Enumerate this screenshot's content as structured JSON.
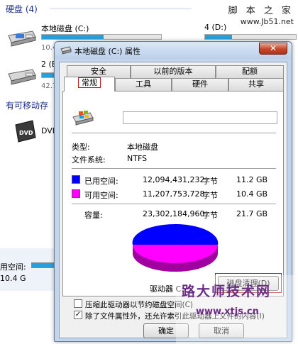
{
  "explorer": {
    "hard_disks_header": "硬盘 (4)",
    "removable_header": "有可移动存",
    "drive_c": {
      "name": "本地磁盘 (C:)",
      "sub": "10.4",
      "used_fraction": 0.52
    },
    "drive_d": {
      "name": "4 (D:)"
    },
    "drive_e": {
      "name": "2 (E",
      "sub": "42.7"
    },
    "dvd": {
      "name": "DVD"
    },
    "status_used": "用空间:",
    "status_free": "10.4 G",
    "watermark_top": "脚 本 之 家",
    "watermark_url": "www.Jb51.net"
  },
  "dialog": {
    "title": "本地磁盘 (C:) 属性",
    "close_glyph": "✕",
    "tabs_row1": [
      "安全",
      "以前的版本",
      "配额"
    ],
    "tabs_row2": [
      "常规",
      "工具",
      "硬件",
      "共享"
    ],
    "type_label": "类型:",
    "type_value": "本地磁盘",
    "fs_label": "文件系统:",
    "fs_value": "NTFS",
    "used_label": "已用空间:",
    "used_bytes": "12,094,431,232",
    "used_unit": "字节",
    "used_gb": "11.2 GB",
    "free_label": "可用空间:",
    "free_bytes": "11,207,753,728",
    "free_unit": "字节",
    "free_gb": "10.4 GB",
    "capacity_label": "容量:",
    "capacity_bytes": "23,302,184,960",
    "capacity_unit": "字节",
    "capacity_gb": "21.7 GB",
    "drive_label": "驱动器 C:",
    "cleanup_button": "磁盘清理(D)",
    "compress_label": "压缩此驱动器以节约磁盘空间(C)",
    "index_label": "除了文件属性外，还允许索引此驱动器上文件的内容(I)",
    "index_checked": "✓",
    "ok_button": "确定",
    "cancel_button": "取消",
    "used_color": "#0000ff",
    "free_color": "#ff00ff"
  },
  "bottom_watermark": {
    "line1": "路大师技术网",
    "line2": "www.xtjs.cn"
  }
}
